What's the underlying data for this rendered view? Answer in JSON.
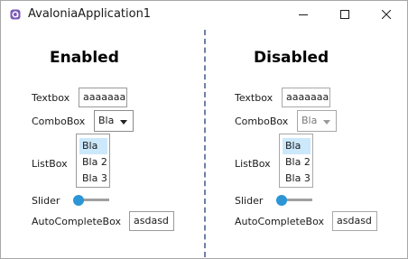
{
  "window": {
    "title": "AvaloniaApplication1",
    "minimize_icon": "minimize-icon",
    "maximize_icon": "maximize-icon",
    "close_icon": "close-icon",
    "app_icon": "avalonia-logo-icon"
  },
  "colors": {
    "accent": "#2B95D6",
    "selection": "#CCE8FB",
    "divider": "#6F7FA8",
    "app_icon": "#7B5AB8"
  },
  "enabled": {
    "heading": "Enabled",
    "textbox_label": "Textbox",
    "textbox_value": "aaaaaaa",
    "combobox_label": "ComboBox",
    "combobox_value": "Bla",
    "listbox_label": "ListBox",
    "listbox_items": [
      "Bla",
      "Bla 2",
      "Bla 3"
    ],
    "listbox_selected_index": 0,
    "slider_label": "Slider",
    "slider_value": 0,
    "autocomplete_label": "AutoCompleteBox",
    "autocomplete_value": "asdasd"
  },
  "disabled": {
    "heading": "Disabled",
    "textbox_label": "Textbox",
    "textbox_value": "aaaaaaa",
    "combobox_label": "ComboBox",
    "combobox_value": "Bla",
    "listbox_label": "ListBox",
    "listbox_items": [
      "Bla",
      "Bla 2",
      "Bla 3"
    ],
    "listbox_selected_index": 0,
    "slider_label": "Slider",
    "slider_value": 0,
    "autocomplete_label": "AutoCompleteBox",
    "autocomplete_value": "asdasd"
  }
}
